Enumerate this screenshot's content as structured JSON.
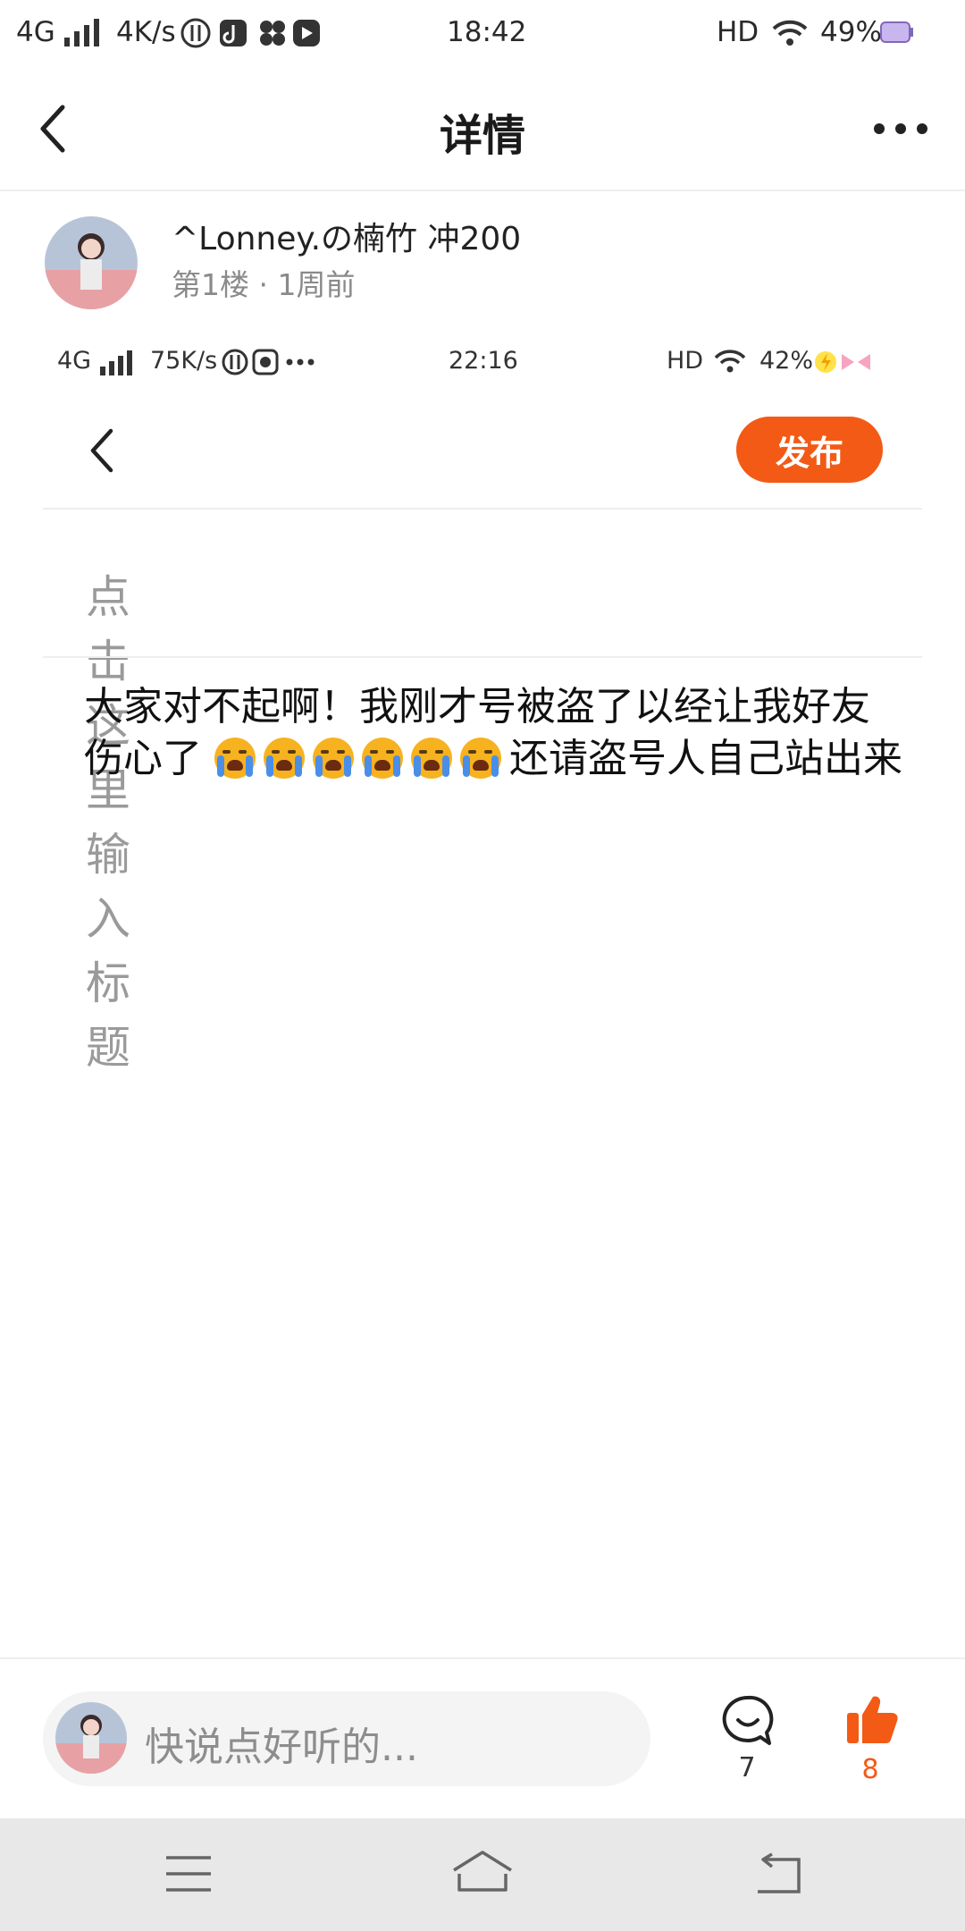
{
  "status_bar": {
    "network": "4G",
    "speed": "4K/s",
    "time": "18:42",
    "hd": "HD",
    "battery": "49%"
  },
  "header": {
    "title": "详情",
    "back_icon": "chevron-left-icon",
    "more_icon": "more-dots-icon"
  },
  "author": {
    "name": "^Lonney.の楠竹 冲200",
    "meta": "第1楼 · 1周前"
  },
  "embedded_screenshot": {
    "status_bar": {
      "network": "4G",
      "speed": "75K/s",
      "time": "22:16",
      "hd": "HD",
      "battery": "42%"
    },
    "publish_label": "发布",
    "title_placeholder": "点击这里输入标题",
    "body_line1": "大家对不起啊！我刚才号被盗了以经让我好友",
    "body_line2_start": "伤心了",
    "body_line2_end": "还请盗号人自己站出来",
    "emoji": "😭"
  },
  "bottom_bar": {
    "comment_placeholder": "快说点好听的...",
    "comment_count": "7",
    "like_count": "8"
  },
  "colors": {
    "accent": "#f35a16",
    "muted": "#8a8a8a",
    "system_nav": "#e8e8e8"
  }
}
